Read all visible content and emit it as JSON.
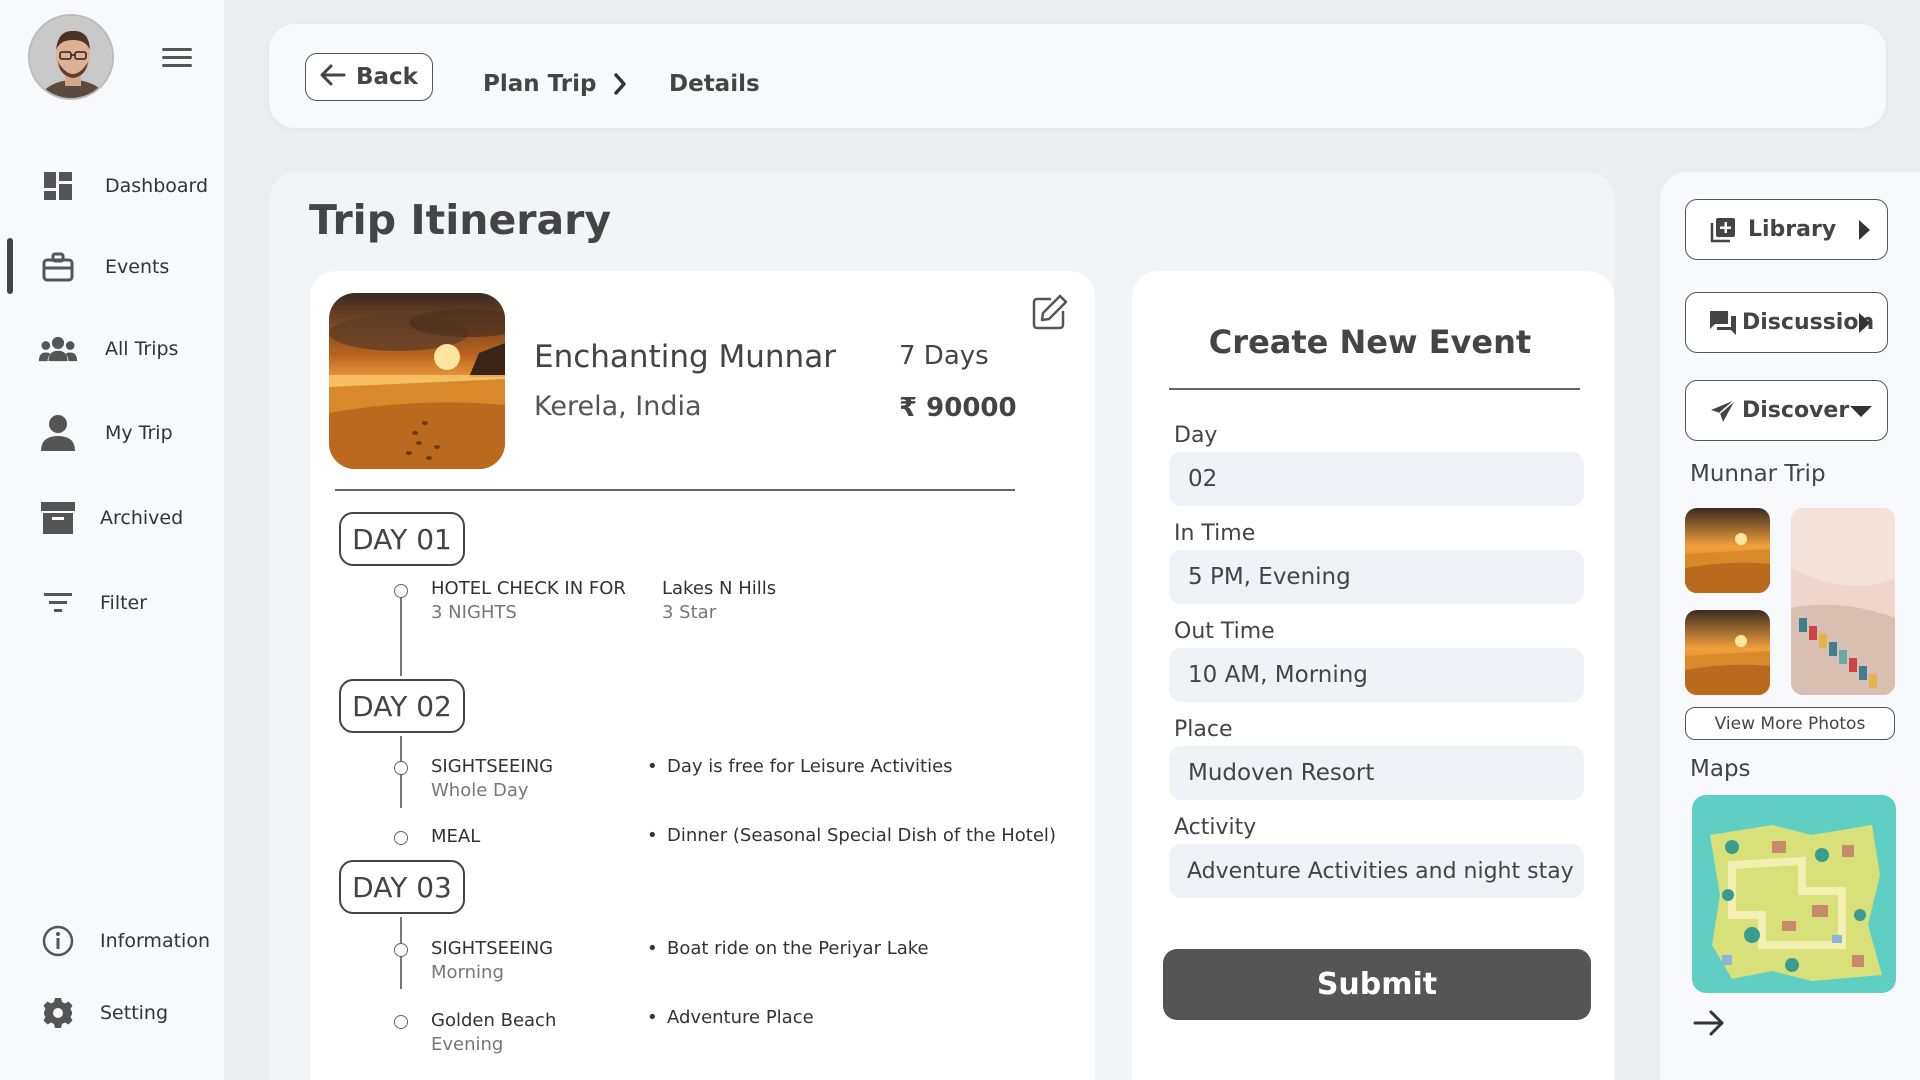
{
  "sidebar": {
    "items": [
      {
        "label": "Dashboard",
        "icon": "dashboard-icon"
      },
      {
        "label": "Events",
        "icon": "briefcase-icon"
      },
      {
        "label": "All Trips",
        "icon": "group-icon"
      },
      {
        "label": "My Trip",
        "icon": "person-icon"
      },
      {
        "label": "Archived",
        "icon": "archive-icon"
      },
      {
        "label": "Filter",
        "icon": "filter-icon"
      }
    ],
    "bottom_items": [
      {
        "label": "Information",
        "icon": "info-icon"
      },
      {
        "label": "Setting",
        "icon": "gear-icon"
      }
    ],
    "active_item": "Events"
  },
  "header": {
    "back_label": "Back",
    "breadcrumb": [
      "Plan Trip",
      "Details"
    ]
  },
  "main": {
    "title": "Trip Itinerary",
    "trip": {
      "name": "Enchanting Munnar",
      "location": "Kerela, India",
      "duration": "7 Days",
      "price": "₹ 90000"
    },
    "days": [
      {
        "label": "DAY 01",
        "events": [
          {
            "title": "HOTEL CHECK IN FOR",
            "subtitle": "3 NIGHTS",
            "detail": "Lakes N Hills",
            "detail_sub": "3 Star"
          }
        ]
      },
      {
        "label": "DAY 02",
        "events": [
          {
            "title": "SIGHTSEEING",
            "subtitle": "Whole Day",
            "bullet": "Day is free for Leisure Activities"
          },
          {
            "title": "MEAL",
            "subtitle": "",
            "bullet": "Dinner (Seasonal Special Dish of the Hotel)"
          }
        ]
      },
      {
        "label": "DAY 03",
        "events": [
          {
            "title": "SIGHTSEEING",
            "subtitle": "Morning",
            "bullet": "Boat ride on the Periyar Lake"
          },
          {
            "title": "Golden Beach",
            "subtitle": "Evening",
            "bullet": "Adventure Place"
          }
        ]
      }
    ]
  },
  "event_form": {
    "title": "Create New Event",
    "fields": [
      {
        "label": "Day",
        "value": "02"
      },
      {
        "label": "In Time",
        "value": "5 PM, Evening"
      },
      {
        "label": "Out Time",
        "value": "10 AM, Morning"
      },
      {
        "label": "Place",
        "value": "Mudoven Resort"
      },
      {
        "label": "Activity",
        "value": "Adventure Activities and night stay"
      }
    ],
    "submit_label": "Submit"
  },
  "right_panel": {
    "buttons": [
      {
        "label": "Library",
        "icon": "library-add-icon"
      },
      {
        "label": "Discussion",
        "icon": "chat-icon"
      },
      {
        "label": "Discover",
        "icon": "send-icon"
      }
    ],
    "photos_title": "Munnar Trip",
    "view_more_label": "View More Photos",
    "maps_title": "Maps"
  },
  "colors": {
    "background": "#ebedf1",
    "card": "#f7f9fc",
    "accent_dark": "#555555",
    "input_bg": "#eff2f7"
  }
}
